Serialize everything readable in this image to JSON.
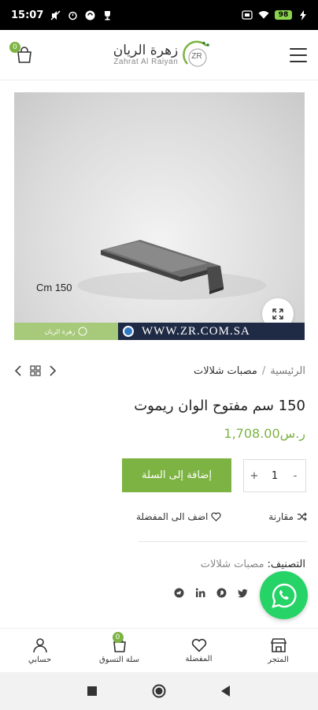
{
  "status_bar": {
    "time": "15:07",
    "battery": "98"
  },
  "header": {
    "cart_count": "0",
    "logo_mark": "ZR",
    "logo_ar": "زهرة الريان",
    "logo_en": "Zahrat Al Raiyan"
  },
  "product_image": {
    "size_label": "Cm 150",
    "banner_url": "WWW.ZR.COM.SA",
    "banner_logo_ar": "زهرة الريان"
  },
  "breadcrumb": {
    "home": "الرئيسية",
    "separator": "/",
    "category": "مصبات شلالات"
  },
  "product": {
    "title": "150 سم مفتوح الوان ريموت",
    "price": "ر.س1,708.00",
    "quantity": "1",
    "minus": "-",
    "plus": "+",
    "add_to_cart": "إضافة إلى السلة",
    "compare": "مقارنة",
    "wishlist": "اضف الى المفضلة",
    "category_label": "التصنيف:",
    "category_value": "مصبات شلالات"
  },
  "bottom_nav": {
    "store": "المتجر",
    "favorites": "المفضلة",
    "cart": "سلة التسوق",
    "cart_count": "0",
    "account": "حسابي"
  },
  "colors": {
    "accent": "#7cb342",
    "whatsapp": "#25d366",
    "banner_dark": "#1f2a44"
  }
}
